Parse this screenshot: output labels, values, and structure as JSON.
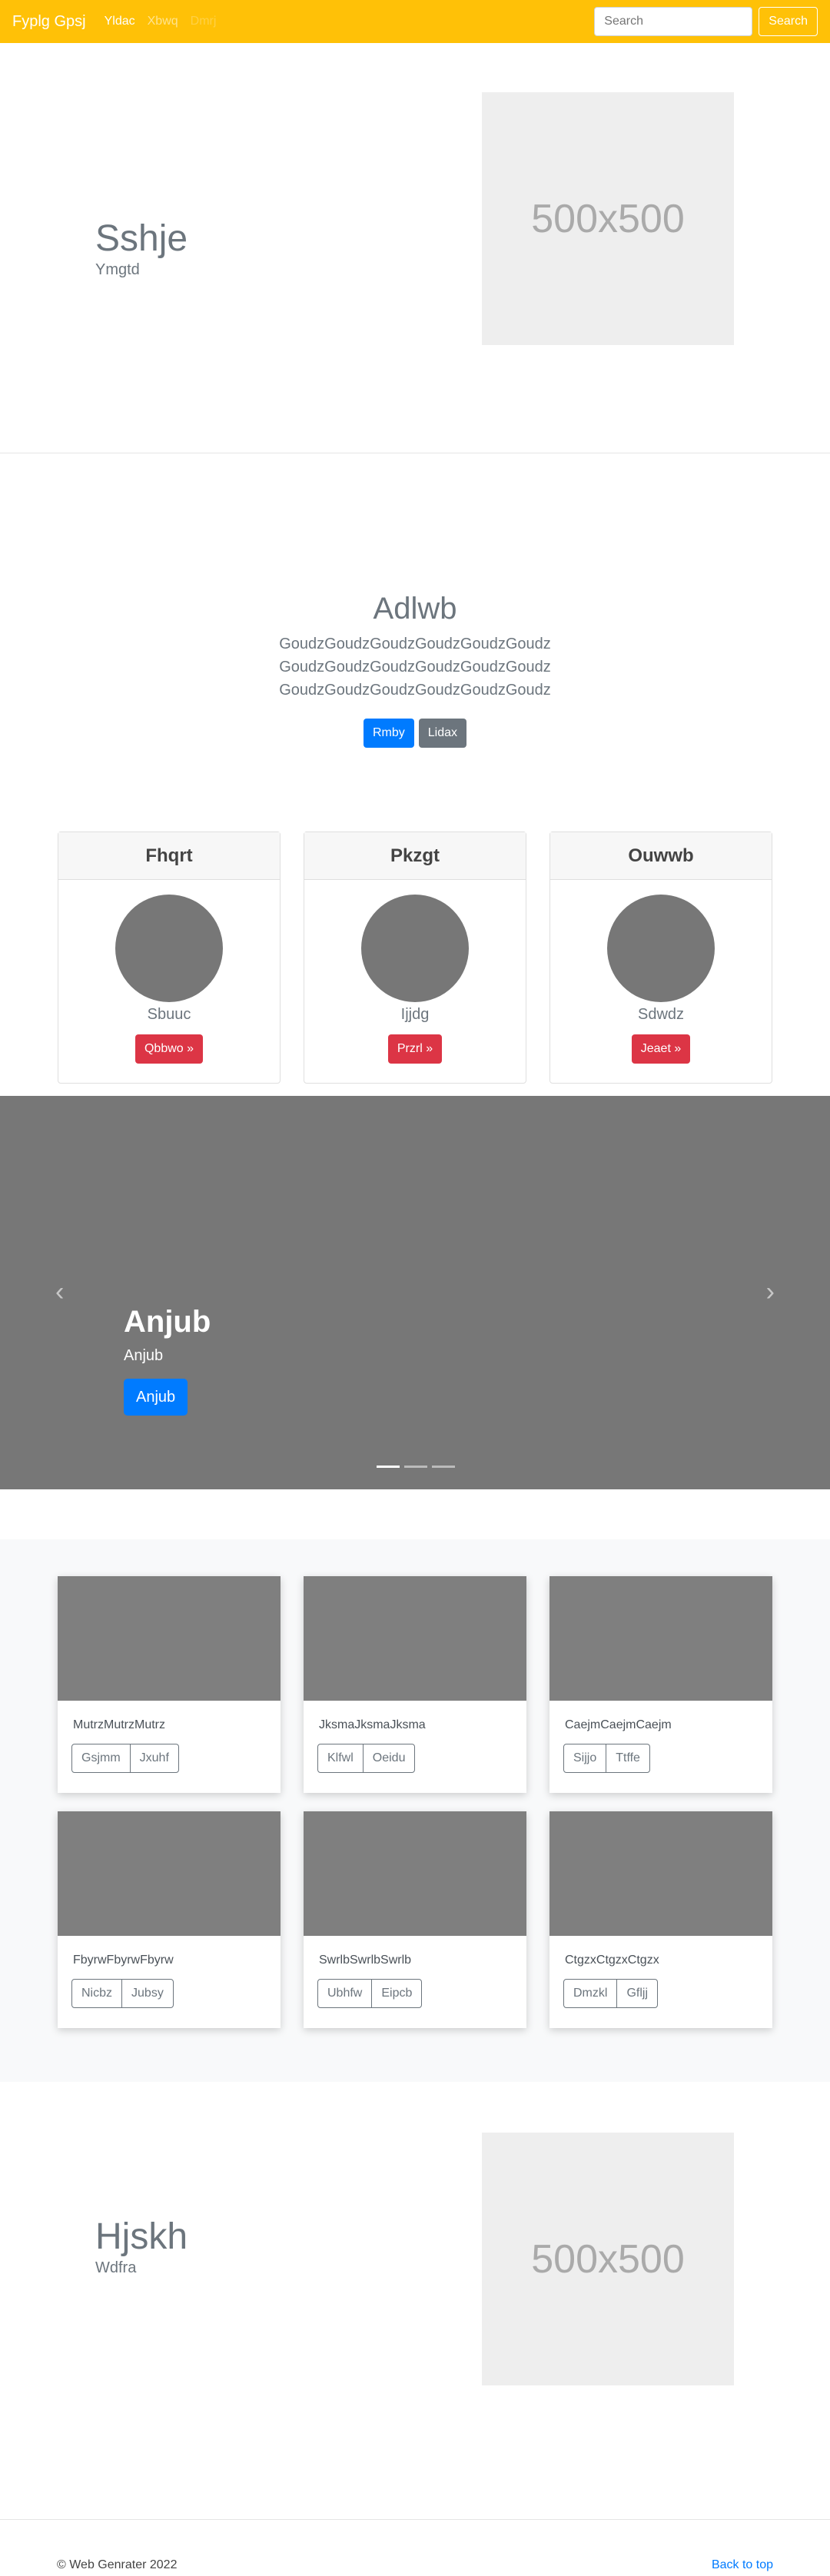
{
  "navbar": {
    "brand": "Fyplg Gpsj",
    "links": [
      "Yldac",
      "Xbwq",
      "Dmrj"
    ],
    "search_placeholder": "Search",
    "search_button": "Search"
  },
  "featurette_1": {
    "heading": "Sshje",
    "lead": "Ymgtd",
    "image_label": "500x500"
  },
  "jumbotron": {
    "title": "Adlwb",
    "lines": [
      "GoudzGoudzGoudzGoudzGoudzGoudz",
      "GoudzGoudzGoudzGoudzGoudzGoudz",
      "GoudzGoudzGoudzGoudzGoudzGoudz"
    ],
    "primary_button": "Rmby",
    "secondary_button": "Lidax"
  },
  "price_cards": [
    {
      "header": "Fhqrt",
      "text": "Sbuuc",
      "button": "Qbbwo »"
    },
    {
      "header": "Pkzgt",
      "text": "Ijjdg",
      "button": "Przrl »"
    },
    {
      "header": "Ouwwb",
      "text": "Sdwdz",
      "button": "Jeaet »"
    }
  ],
  "carousel": {
    "title": "Anjub",
    "subtitle": "Anjub",
    "button": "Anjub",
    "slide_count": 3,
    "active_slide": 1
  },
  "album": [
    {
      "text": "MutrzMutrzMutrz",
      "buttons": [
        "Gsjmm",
        "Jxuhf"
      ]
    },
    {
      "text": "JksmaJksmaJksma",
      "buttons": [
        "Klfwl",
        "Oeidu"
      ]
    },
    {
      "text": "CaejmCaejmCaejm",
      "buttons": [
        "Sijjo",
        "Ttffe"
      ]
    },
    {
      "text": "FbyrwFbyrwFbyrw",
      "buttons": [
        "Nicbz",
        "Jubsy"
      ]
    },
    {
      "text": "SwrlbSwrlbSwrlb",
      "buttons": [
        "Ubhfw",
        "Eipcb"
      ]
    },
    {
      "text": "CtgzxCtgzxCtgzx",
      "buttons": [
        "Dmzkl",
        "Gfljj"
      ]
    }
  ],
  "featurette_2": {
    "heading": "Hjskh",
    "lead": "Wdfra",
    "image_label": "500x500"
  },
  "footer": {
    "copyright": "© Web Genrater 2022",
    "back_to_top": "Back to top"
  }
}
